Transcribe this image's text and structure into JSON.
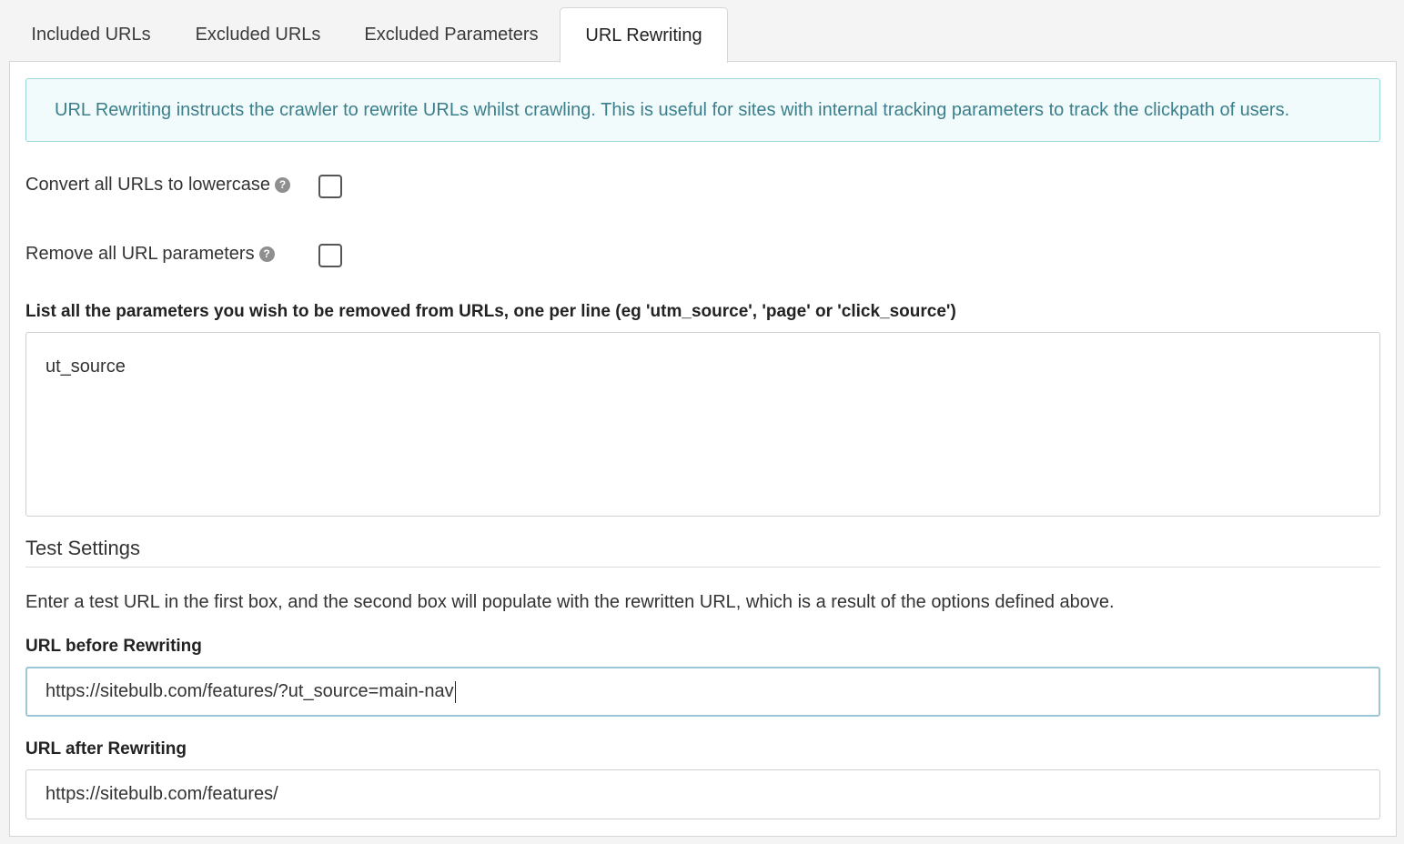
{
  "tabs": [
    {
      "label": "Included URLs",
      "active": false
    },
    {
      "label": "Excluded URLs",
      "active": false
    },
    {
      "label": "Excluded Parameters",
      "active": false
    },
    {
      "label": "URL Rewriting",
      "active": true
    }
  ],
  "info_text": "URL Rewriting instructs the crawler to rewrite URLs whilst crawling. This is useful for sites with internal tracking parameters to track the clickpath of users.",
  "options": {
    "lowercase_label": "Convert all URLs to lowercase",
    "lowercase_checked": false,
    "remove_params_label": "Remove all URL parameters",
    "remove_params_checked": false,
    "help_glyph": "?"
  },
  "params_list": {
    "label": "List all the parameters you wish to be removed from URLs, one per line (eg 'utm_source', 'page' or 'click_source')",
    "value": "ut_source"
  },
  "test_settings": {
    "title": "Test Settings",
    "description": "Enter a test URL in the first box, and the second box will populate with the rewritten URL, which is a result of the options defined above.",
    "before_label": "URL before Rewriting",
    "before_value": "https://sitebulb.com/features/?ut_source=main-nav",
    "after_label": "URL after Rewriting",
    "after_value": "https://sitebulb.com/features/"
  },
  "colors": {
    "info_bg": "#f1fbfb",
    "info_border": "#9cd7dc",
    "info_text": "#3b7f8c",
    "focus_border": "#9cc6d8"
  }
}
